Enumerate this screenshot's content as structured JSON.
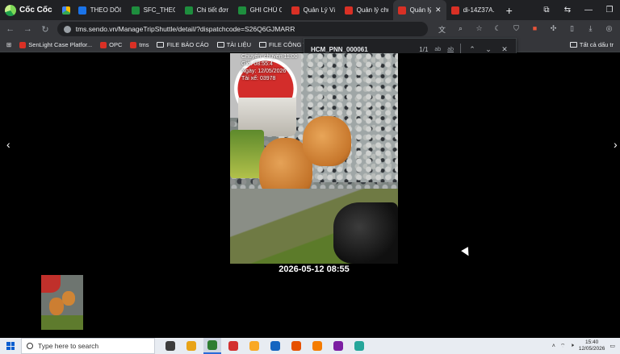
{
  "browser": {
    "brand": "Cốc Cốc",
    "tabs": [
      {
        "label": "THEO DÕI V",
        "favicon_color": "#1a73e8",
        "active": false
      },
      {
        "label": "SFC_THEO D",
        "favicon_color": "#1e8e3e",
        "active": false
      },
      {
        "label": "Chi tiết đơn",
        "favicon_color": "#1e8e3e",
        "active": false
      },
      {
        "label": "GHI CHÚ CỐ",
        "favicon_color": "#1e8e3e",
        "active": false
      },
      {
        "label": "Quản Lý Vận",
        "favicon_color": "#d93025",
        "active": false
      },
      {
        "label": "Quản lý chu",
        "favicon_color": "#d93025",
        "active": false
      },
      {
        "label": "Quản lý",
        "favicon_color": "#d93025",
        "active": true
      },
      {
        "label": "di-14Z37A.p",
        "favicon_color": "#d93025",
        "active": false
      }
    ],
    "url": "tms.sendo.vn/ManageTripShuttle/detail/?dispatchcode=S26Q6GJMARR",
    "bookmarks": [
      {
        "label": "SenLight Case Platfor...",
        "type": "site"
      },
      {
        "label": "OPC",
        "type": "site"
      },
      {
        "label": "tms",
        "type": "site"
      },
      {
        "label": "FILE BÁO CÁO",
        "type": "folder"
      },
      {
        "label": "TÀI LIỆU",
        "type": "folder"
      },
      {
        "label": "FILE CÔNG VIỆC",
        "type": "folder"
      }
    ],
    "bookmarks_right": "Tất cả dấu tr",
    "find": {
      "query": "HCM_PNN_000061",
      "count": "1/1",
      "opt1": "ab",
      "opt2": "ab"
    }
  },
  "viewer": {
    "stamp_lines": [
      "Chuyến: chuyến 11:00",
      "Giờ: 08:55:4",
      "Ngày: 12/05/2026",
      "Tài xế: 03978"
    ],
    "caption": "2026-05-12 08:55"
  },
  "taskbar": {
    "search_placeholder": "Type here to search",
    "time": "15:40",
    "date": "12/05/2026",
    "apps": [
      "#3c3c3c",
      "#e8a317",
      "#2e7d32",
      "#d32f2f",
      "#f9a825",
      "#1565c0",
      "#e65100",
      "#f57c00",
      "#7b1fa2",
      "#26a69a"
    ]
  }
}
